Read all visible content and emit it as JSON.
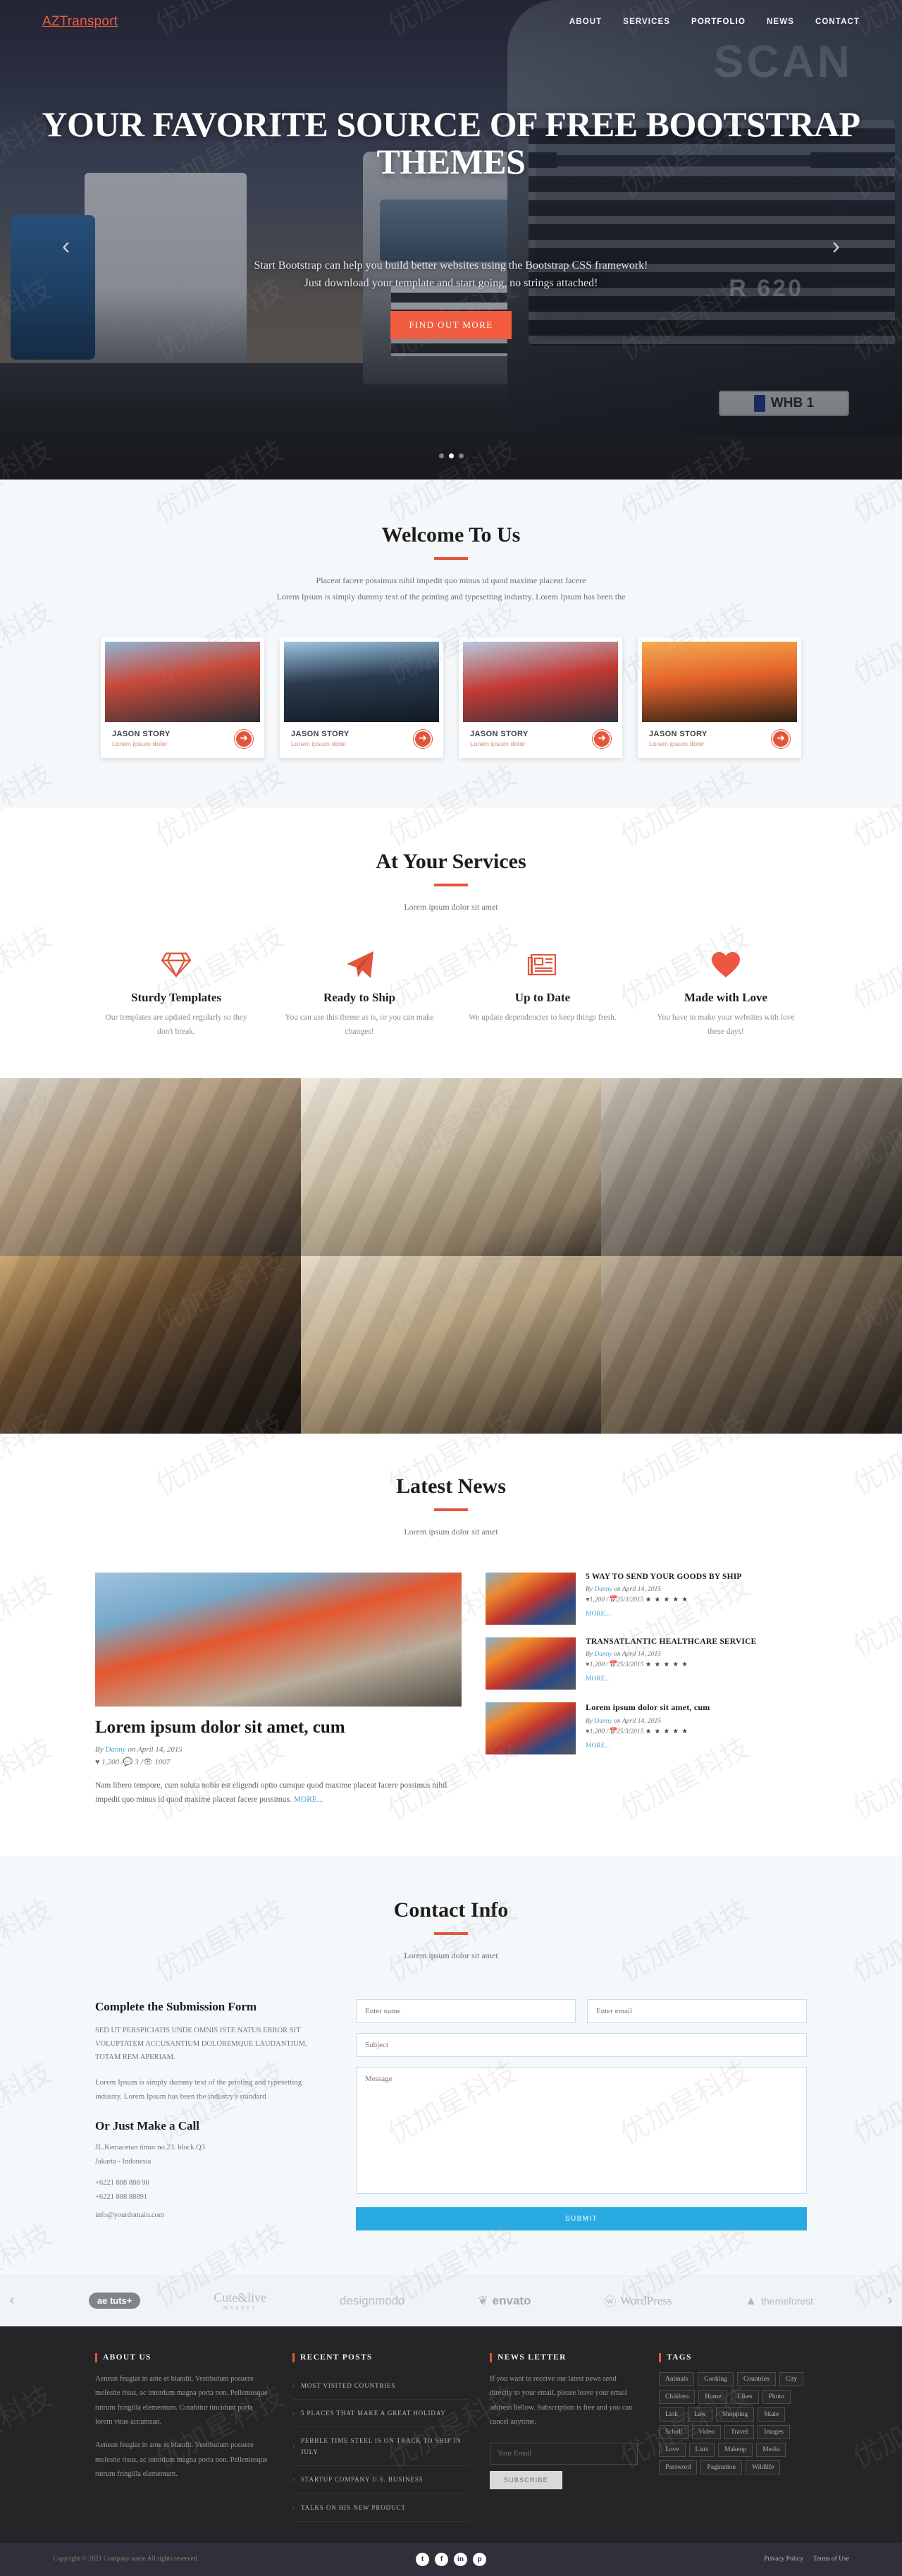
{
  "nav": {
    "brand": "AZTransport",
    "links": [
      {
        "label": "ABOUT"
      },
      {
        "label": "SERVICES"
      },
      {
        "label": "PORTFOLIO"
      },
      {
        "label": "NEWS"
      },
      {
        "label": "CONTACT"
      }
    ]
  },
  "hero": {
    "title": "YOUR FAVORITE SOURCE OF FREE BOOTSTRAP THEMES",
    "subtitle_line1": "Start Bootstrap can help you build better websites using the Bootstrap CSS framework!",
    "subtitle_line2": "Just download your template and start going, no strings attached!",
    "button": "FIND OUT MORE",
    "prev_icon": "chevron-left-icon",
    "next_icon": "chevron-right-icon",
    "truck_badge": "SCAN",
    "truck_model": "R 620",
    "plate": "WHB 1"
  },
  "welcome": {
    "title": "Welcome To Us",
    "sub_line1": "Placeat facere possimus nihil impedit quo minus id quod maxime placeat facere",
    "sub_line2": "Lorem Ipsum is simply dummy text of the printing and typesetting industry. Lorem Ipsum has been the",
    "cards": [
      {
        "name": "JASON STORY",
        "desc": "Lorem ipsum dolor"
      },
      {
        "name": "JASON STORY",
        "desc": "Lorem ipsum dolor"
      },
      {
        "name": "JASON STORY",
        "desc": "Lorem ipsum dolor"
      },
      {
        "name": "JASON STORY",
        "desc": "Lorem ipsum dolor"
      }
    ]
  },
  "services": {
    "title": "At Your Services",
    "sub": "Lorem ipsum dolor sit amet",
    "items": [
      {
        "icon": "diamond-icon",
        "name": "Sturdy Templates",
        "desc": "Our templates are updated regularly so they don't break."
      },
      {
        "icon": "paper-plane-icon",
        "name": "Ready to Ship",
        "desc": "You can use this theme as is, or you can make changes!"
      },
      {
        "icon": "newspaper-icon",
        "name": "Up to Date",
        "desc": "We update dependencies to keep things fresh."
      },
      {
        "icon": "heart-icon",
        "name": "Made with Love",
        "desc": "You have to make your websites with love these days!"
      }
    ]
  },
  "news": {
    "title": "Latest News",
    "sub": "Lorem ipsum dolor sit amet",
    "featured": {
      "title": "Lorem ipsum dolor sit amet, cum",
      "by_prefix": "By",
      "author": "Danny",
      "date": "on April 14, 2015",
      "likes": "1,200",
      "comments": "3",
      "views": "1007",
      "body": "Nam libero tempore, cum soluta nobis est eligendi optio cumque quod maxime placeat facere possimus nihil impedit quo minus id quod maxime placeat facere possimus.",
      "more": "MORE..."
    },
    "items": [
      {
        "title": "5 WAY TO SEND YOUR GOODS BY SHIP",
        "by_prefix": "By",
        "author": "Danny",
        "date": "on April 14, 2015",
        "likes": "1,200",
        "post_date": "25/3/2015",
        "stars": "★ ★ ★ ★ ★",
        "more": "MORE..."
      },
      {
        "title": "TRANSATLANTIC HEALTHCARE SERVICE",
        "by_prefix": "By",
        "author": "Danny",
        "date": "on April 14, 2015",
        "likes": "1,200",
        "post_date": "25/3/2015",
        "stars": "★ ★ ★ ★ ★",
        "more": "MORE..."
      },
      {
        "title": "Lorem ipsum dolor sit amet, cum",
        "by_prefix": "By",
        "author": "Danny",
        "date": "on April 14, 2015",
        "likes": "1,200",
        "post_date": "25/3/2015",
        "stars": "★ ★ ★ ★ ★",
        "more": "MORE..."
      }
    ]
  },
  "contact": {
    "title": "Contact Info",
    "sub": "Lorem ipsum dolor sit amet",
    "form_heading": "Complete the Submission Form",
    "caps_text": "SED UT PERSPICIATIS UNDE OMNIS ISTE NATUS ERROR SIT VOLUPTATEM ACCUSANTIUM DOLOREMQUE LAUDANTIUM, TOTAM REM APERIAM.",
    "paragraph": "Lorem Ipsum is simply dummy text of the printing and typesetting industry. Lorem Ipsum has been the industry's standard",
    "call_heading": "Or Just Make a Call",
    "address_line1": "JL.Kemacetan timur no.23. block.Q3",
    "address_line2": "Jakarta - Indonesia",
    "phone1": "+6221 888 888 90",
    "phone2": "+6221 888 88891",
    "email": "info@yourdomain.com",
    "name_placeholder": "Enter name",
    "email_placeholder": "Enter email",
    "subject_placeholder": "Subject",
    "message_placeholder": "Message",
    "submit_label": "SUBMIT"
  },
  "brands": {
    "items": [
      {
        "name": "aetuts-logo",
        "label": "ae tuts+"
      },
      {
        "name": "cute-logo",
        "label": "Cute&live",
        "sub": "MARKET"
      },
      {
        "name": "designmodo-logo",
        "label": "designmodo"
      },
      {
        "name": "envato-logo",
        "label": "envato"
      },
      {
        "name": "wordpress-logo",
        "label": "WordPress"
      },
      {
        "name": "themeforest-logo",
        "label": "themeforest"
      }
    ],
    "prev_icon": "chevron-left-icon",
    "next_icon": "chevron-right-icon"
  },
  "footer": {
    "about": {
      "heading": "ABOUT US",
      "p1": "Aenean feugiat in ante et blandit. Vestibulum posuere molestie risus, ac interdum magna porta non. Pellentesque rutrum fringilla elementum. Curabitur tincidunt porta lorem vitae accumsan.",
      "p2": "Aenean feugiat in ante et blandit. Vestibulum posuere molestie risus, ac interdum magna porta non. Pellentesque rutrum fringilla elementum."
    },
    "recent": {
      "heading": "RECENT POSTS",
      "items": [
        "MOST VISITED COUNTRIES",
        "5 PLACES THAT MAKE A GREAT HOLIDAY",
        "PEBBLE TIME STEEL IS ON TRACK TO SHIP IN JULY",
        "STARTUP COMPANY U.S. BUSINESS",
        "TALKS ON HIS NEW PRODUCT"
      ]
    },
    "newsletter": {
      "heading": "NEWS LETTER",
      "text": "If you want to receive our latest news send directly to your email, please leave your email address bellow. Subscription is free and you can cancel anytime.",
      "placeholder": "Your Email",
      "button": "SUBSCRIBE"
    },
    "tags": {
      "heading": "TAGS",
      "items": [
        "Animals",
        "Cooking",
        "Countries",
        "City",
        "Children",
        "Home",
        "Likes",
        "Photo",
        "Link",
        "Law",
        "Shopping",
        "Skate",
        "Scholl",
        "Video",
        "Travel",
        "Images",
        "Love",
        "Lists",
        "Makeup",
        "Media",
        "Password",
        "Pagination",
        "Wildlife"
      ]
    }
  },
  "copyright": {
    "text": "Copyright © 2021 Company name All rights reserved.",
    "socials": [
      {
        "name": "twitter-icon",
        "glyph": "t"
      },
      {
        "name": "facebook-icon",
        "glyph": "f"
      },
      {
        "name": "linkedin-icon",
        "glyph": "in"
      },
      {
        "name": "pinterest-icon",
        "glyph": "p"
      }
    ],
    "links": [
      {
        "label": "Privacy Policy"
      },
      {
        "label": "Terms of Use"
      }
    ]
  },
  "colors": {
    "accent": "#e2573c",
    "brand": "#ef5b43",
    "link": "#4ba3d4",
    "submit": "#29abe2"
  }
}
